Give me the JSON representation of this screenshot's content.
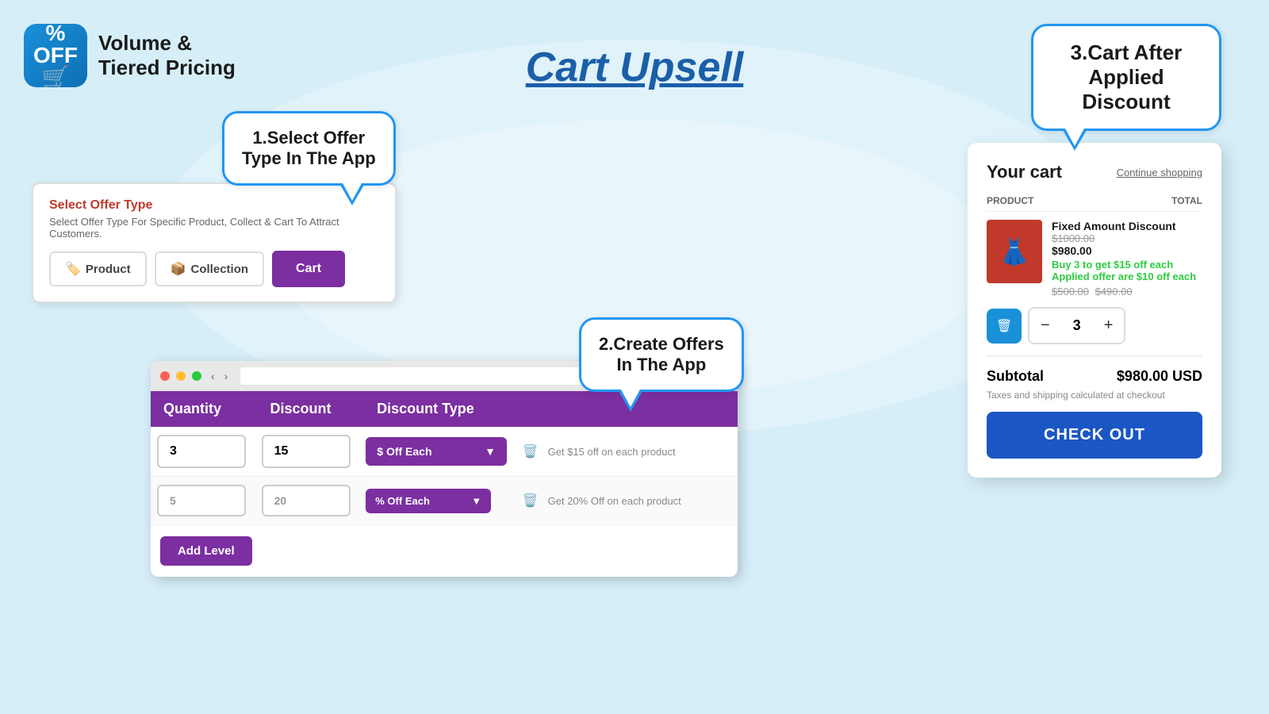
{
  "app": {
    "logo_emoji": "%\nOFF",
    "title_line1": "Volume &",
    "title_line2": "Tiered Pricing"
  },
  "page": {
    "title": "Cart Upsell"
  },
  "step1": {
    "bubble": "1.Select Offer\nType In The App"
  },
  "step2": {
    "bubble": "2.Create Offers\nIn The App"
  },
  "step3": {
    "bubble": "3.Cart After\nApplied Discount"
  },
  "offer_panel": {
    "title": "Select Offer Type",
    "description": "Select Offer Type For Specific Product, Collect & Cart To Attract Customers.",
    "buttons": [
      {
        "label": "Product",
        "icon": "🏷️",
        "active": false
      },
      {
        "label": "Collection",
        "icon": "📦",
        "active": false
      },
      {
        "label": "Cart",
        "icon": "",
        "active": true
      }
    ]
  },
  "discount_table": {
    "columns": [
      "Quantity",
      "Discount",
      "Discount Type",
      ""
    ],
    "rows": [
      {
        "qty": "3",
        "discount": "15",
        "type": "$ Off Each",
        "hint": "Get $15 off on each product"
      },
      {
        "qty": "5",
        "discount": "20",
        "type": "% Off Each",
        "hint": "Get 20% Off on each product"
      }
    ],
    "add_level_label": "Add Level"
  },
  "cart": {
    "title": "Your cart",
    "continue_shopping": "Continue shopping",
    "col_product": "PRODUCT",
    "col_total": "TOTAL",
    "item": {
      "name": "Fixed Amount Discount",
      "price_original": "$1000.00",
      "price_current": "$980.00",
      "offer_text": "Buy 3 to get $15 off each",
      "applied_text": "Applied offer are $10 off each",
      "price_strike": "$500.00",
      "price_discounted": "$490.00"
    },
    "quantity": "3",
    "subtotal_label": "Subtotal",
    "subtotal_value": "$980.00 USD",
    "tax_text": "Taxes and shipping calculated at checkout",
    "checkout_label": "CHECK OUT"
  }
}
